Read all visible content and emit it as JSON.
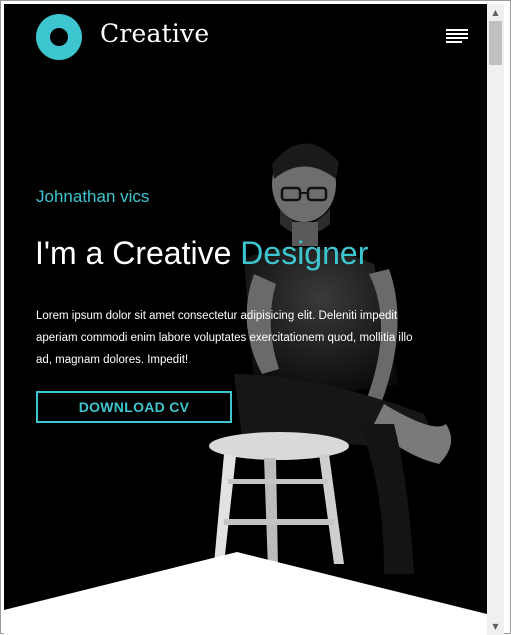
{
  "brand": {
    "name": "Creative"
  },
  "hero": {
    "subtitle": "Johnathan vics",
    "headline_prefix": "I'm a Creative ",
    "headline_accent": "Designer",
    "paragraph": "Lorem ipsum dolor sit amet consectetur adipisicing elit. Deleniti impedit aperiam commodi enim labore voluptates exercitationem quod, mollitia illo ad, magnam dolores. Impedit!",
    "button_label": "DOWNLOAD CV"
  },
  "colors": {
    "accent": "#3ec6d0",
    "background": "#000000",
    "text": "#ffffff"
  },
  "icons": {
    "logo": "ring-logo-icon",
    "menu": "hamburger-menu-icon"
  }
}
